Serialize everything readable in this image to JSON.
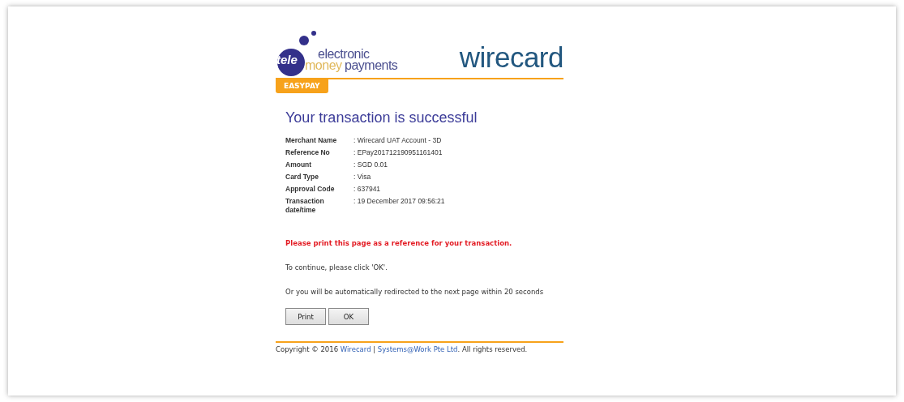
{
  "logo": {
    "tele": "tele",
    "electronic": "electronic",
    "money": "money",
    "payments": "payments",
    "brand": "wirecard",
    "tab": "EASYPAY"
  },
  "heading": "Your transaction is successful",
  "details": [
    {
      "label": "Merchant Name",
      "value": ": Wirecard UAT Account - 3D"
    },
    {
      "label": "Reference No",
      "value": ": EPay201712190951161401"
    },
    {
      "label": "Amount",
      "value": ": SGD 0.01"
    },
    {
      "label": "Card Type",
      "value": ": Visa"
    },
    {
      "label": "Approval Code",
      "value": ": 637941"
    },
    {
      "label": "Transaction date/time",
      "value": ": 19 December 2017 09:56:21"
    }
  ],
  "notice": "Please print this page as a reference for your transaction.",
  "messages": [
    "To continue, please click 'OK'.",
    "Or you will be automatically redirected to the next page within 20 seconds"
  ],
  "buttons": [
    "Print",
    "OK"
  ],
  "footer": {
    "before": "Copyright © 2016 ",
    "link1": "Wirecard",
    "separator": " | ",
    "link2": "Systems@Work Pte Ltd",
    "after": ". All rights reserved."
  }
}
